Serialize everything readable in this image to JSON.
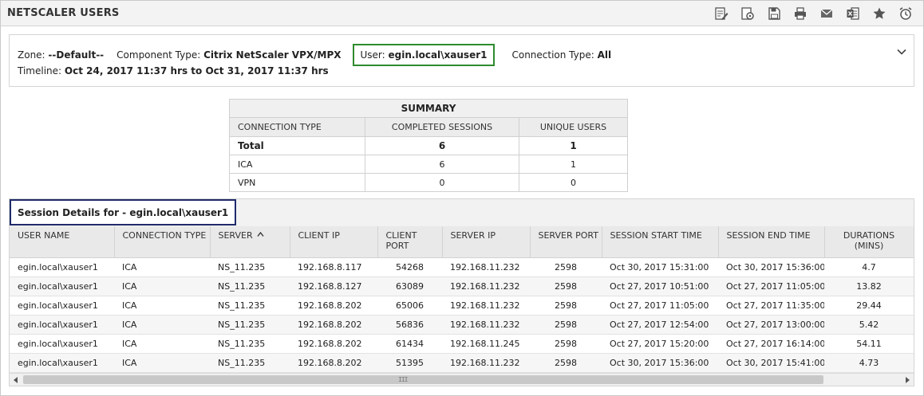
{
  "header": {
    "title": "NETSCALER USERS",
    "toolbar": [
      {
        "name": "edit-report-icon"
      },
      {
        "name": "configure-icon"
      },
      {
        "name": "save-icon"
      },
      {
        "name": "print-icon"
      },
      {
        "name": "email-icon"
      },
      {
        "name": "excel-export-icon"
      },
      {
        "name": "favorite-star-icon"
      },
      {
        "name": "schedule-alarm-icon"
      }
    ]
  },
  "filters": {
    "zone_label": "Zone:",
    "zone_value": "--Default--",
    "component_label": "Component Type:",
    "component_value": "Citrix NetScaler VPX/MPX",
    "user_label": "User:",
    "user_value": "egin.local\\xauser1",
    "connection_label": "Connection Type:",
    "connection_value": "All",
    "timeline_label": "Timeline:",
    "timeline_value": "Oct 24, 2017 11:37 hrs to Oct 31, 2017 11:37 hrs"
  },
  "summary": {
    "caption": "SUMMARY",
    "headers": [
      "CONNECTION TYPE",
      "COMPLETED SESSIONS",
      "UNIQUE USERS"
    ],
    "rows": [
      {
        "type": "Total",
        "sessions": "6",
        "users": "1"
      },
      {
        "type": "ICA",
        "sessions": "6",
        "users": "1"
      },
      {
        "type": "VPN",
        "sessions": "0",
        "users": "0"
      }
    ]
  },
  "details": {
    "title": "Session Details for - egin.local\\xauser1",
    "headers": {
      "user_name": "USER NAME",
      "connection_type": "CONNECTION TYPE",
      "server": "SERVER",
      "client_ip": "CLIENT IP",
      "client_port": "CLIENT PORT",
      "server_ip": "SERVER IP",
      "server_port": "SERVER PORT",
      "start_time": "SESSION START TIME",
      "end_time": "SESSION END TIME",
      "duration": "DURATIONS",
      "duration_unit": "(MINS)"
    },
    "rows": [
      {
        "user": "egin.local\\xauser1",
        "conn": "ICA",
        "server": "NS_11.235",
        "client_ip": "192.168.8.117",
        "client_port": "54268",
        "server_ip": "192.168.11.232",
        "server_port": "2598",
        "start": "Oct 30, 2017 15:31:00",
        "end": "Oct 30, 2017 15:36:00",
        "duration": "4.7"
      },
      {
        "user": "egin.local\\xauser1",
        "conn": "ICA",
        "server": "NS_11.235",
        "client_ip": "192.168.8.127",
        "client_port": "63089",
        "server_ip": "192.168.11.232",
        "server_port": "2598",
        "start": "Oct 27, 2017 10:51:00",
        "end": "Oct 27, 2017 11:05:00",
        "duration": "13.82"
      },
      {
        "user": "egin.local\\xauser1",
        "conn": "ICA",
        "server": "NS_11.235",
        "client_ip": "192.168.8.202",
        "client_port": "65006",
        "server_ip": "192.168.11.232",
        "server_port": "2598",
        "start": "Oct 27, 2017 11:05:00",
        "end": "Oct 27, 2017 11:35:00",
        "duration": "29.44"
      },
      {
        "user": "egin.local\\xauser1",
        "conn": "ICA",
        "server": "NS_11.235",
        "client_ip": "192.168.8.202",
        "client_port": "56836",
        "server_ip": "192.168.11.232",
        "server_port": "2598",
        "start": "Oct 27, 2017 12:54:00",
        "end": "Oct 27, 2017 13:00:00",
        "duration": "5.42"
      },
      {
        "user": "egin.local\\xauser1",
        "conn": "ICA",
        "server": "NS_11.235",
        "client_ip": "192.168.8.202",
        "client_port": "61434",
        "server_ip": "192.168.11.245",
        "server_port": "2598",
        "start": "Oct 27, 2017 15:20:00",
        "end": "Oct 27, 2017 16:14:00",
        "duration": "54.11"
      },
      {
        "user": "egin.local\\xauser1",
        "conn": "ICA",
        "server": "NS_11.235",
        "client_ip": "192.168.8.202",
        "client_port": "51395",
        "server_ip": "192.168.11.232",
        "server_port": "2598",
        "start": "Oct 30, 2017 15:36:00",
        "end": "Oct 30, 2017 15:41:00",
        "duration": "4.73"
      }
    ],
    "scroll_grip": "III"
  }
}
